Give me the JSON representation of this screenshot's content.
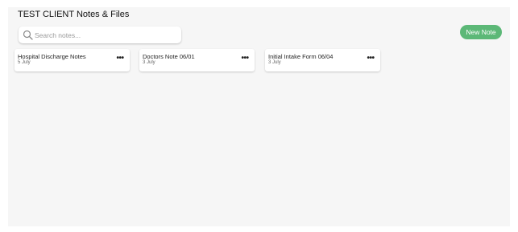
{
  "header": {
    "title": "TEST CLIENT Notes & Files"
  },
  "search": {
    "placeholder": "Search notes...",
    "value": "",
    "icon": "search-icon"
  },
  "toolbar": {
    "new_note_label": "New Note",
    "accent_color": "#5cb877"
  },
  "notes": [
    {
      "title": "Hospital Discharge Notes",
      "date": "5 July",
      "menu_icon": "more-horizontal-icon"
    },
    {
      "title": "Doctors Note 06/01",
      "date": "3 July",
      "menu_icon": "more-horizontal-icon"
    },
    {
      "title": "Initial Intake Form 06/04",
      "date": "3 July",
      "menu_icon": "more-horizontal-icon"
    }
  ],
  "menu_glyph": "•••"
}
